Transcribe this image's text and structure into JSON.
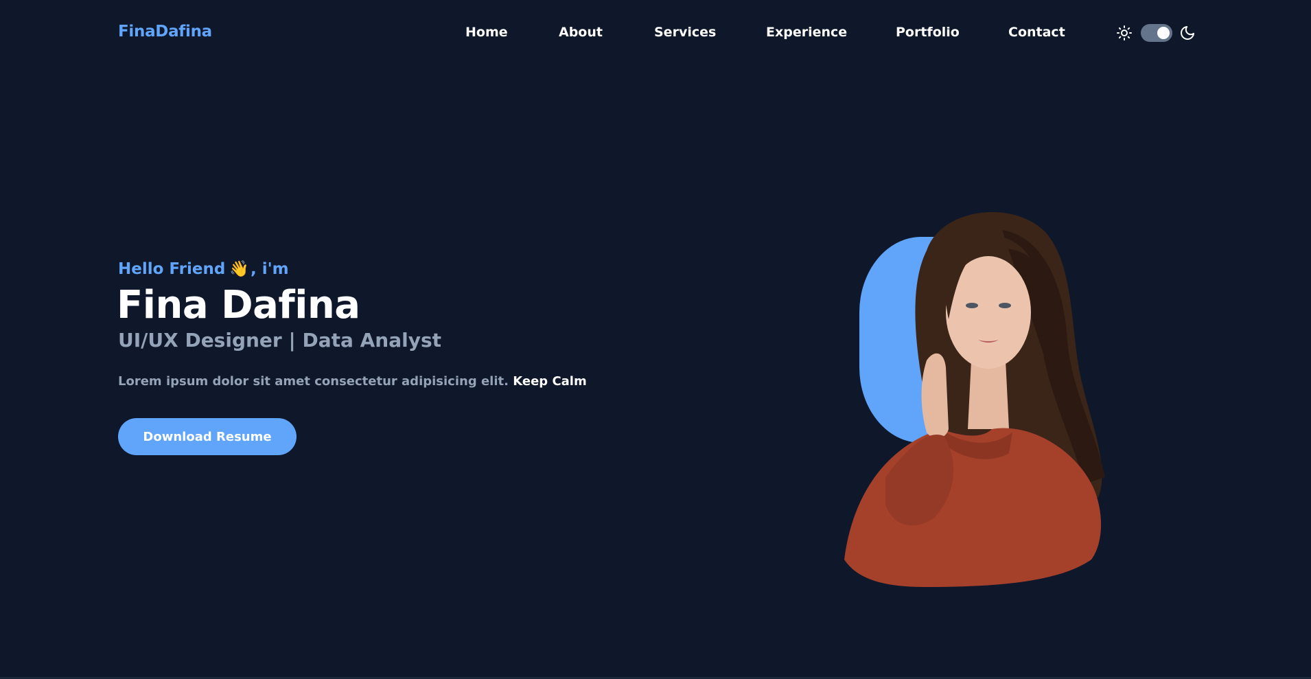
{
  "nav": {
    "brand": "FinaDafina",
    "links": [
      "Home",
      "About",
      "Services",
      "Experience",
      "Portfolio",
      "Contact"
    ],
    "theme": {
      "mode": "dark",
      "sun_icon": "sun-icon",
      "moon_icon": "moon-icon"
    }
  },
  "hero": {
    "greeting_prefix": "Hello Friend",
    "greeting_emoji": "👋",
    "greeting_suffix": ", i'm",
    "name": "Fina Dafina",
    "role": "UI/UX Designer | Data Analyst",
    "description": "Lorem ipsum dolor sit amet consectetur adipisicing elit.",
    "description_accent": "Keep Calm",
    "cta_label": "Download Resume"
  },
  "colors": {
    "background": "#0f172a",
    "accent": "#60a5fa",
    "muted": "#94a3b8",
    "sweater": "#a5412b",
    "hair": "#3b2418"
  }
}
